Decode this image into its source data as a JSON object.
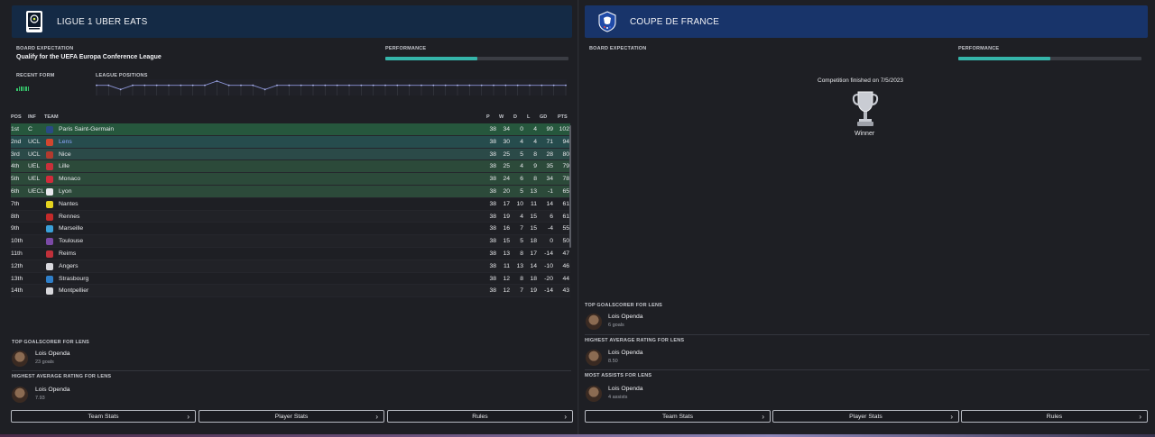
{
  "league": {
    "title": "LIGUE 1 UBER EATS",
    "board_expectation_label": "BOARD EXPECTATION",
    "board_expectation_value": "Qualify for the UEFA Europa Conference League",
    "performance_label": "PERFORMANCE",
    "performance_fill": 0.5,
    "recent_form_label": "RECENT FORM",
    "league_positions_label": "LEAGUE POSITIONS",
    "positions_history": [
      2,
      2,
      3,
      2,
      2,
      2,
      2,
      2,
      2,
      2,
      1,
      2,
      2,
      2,
      3,
      2,
      2,
      2,
      2,
      2,
      2,
      2,
      2,
      2,
      2,
      2,
      2,
      2,
      2,
      2,
      2,
      2,
      2,
      2,
      2,
      2,
      2,
      2,
      2,
      2
    ],
    "table": {
      "headers": [
        "POS",
        "INF",
        "TEAM",
        "P",
        "W",
        "D",
        "L",
        "GD",
        "PTS"
      ],
      "rows": [
        {
          "pos": "1st",
          "inf": "C",
          "team": "Paris Saint-Germain",
          "p": "38",
          "w": "34",
          "d": "0",
          "l": "4",
          "gd": "99",
          "pts": "102",
          "crest": "#2a4a86",
          "zone": "c1"
        },
        {
          "pos": "2nd",
          "inf": "UCL",
          "team": "Lens",
          "p": "38",
          "w": "30",
          "d": "4",
          "l": "4",
          "gd": "71",
          "pts": "94",
          "crest": "#d1462f",
          "zone": "c2",
          "highlight": true
        },
        {
          "pos": "3rd",
          "inf": "UCL",
          "team": "Nice",
          "p": "38",
          "w": "25",
          "d": "5",
          "l": "8",
          "gd": "28",
          "pts": "80",
          "crest": "#b33a2e",
          "zone": "c3"
        },
        {
          "pos": "4th",
          "inf": "UEL",
          "team": "Lille",
          "p": "38",
          "w": "25",
          "d": "4",
          "l": "9",
          "gd": "35",
          "pts": "79",
          "crest": "#c8303a",
          "zone": "c4"
        },
        {
          "pos": "5th",
          "inf": "UEL",
          "team": "Monaco",
          "p": "38",
          "w": "24",
          "d": "6",
          "l": "8",
          "gd": "34",
          "pts": "78",
          "crest": "#d12b3b",
          "zone": "c4"
        },
        {
          "pos": "6th",
          "inf": "UECL",
          "team": "Lyon",
          "p": "38",
          "w": "20",
          "d": "5",
          "l": "13",
          "gd": "-1",
          "pts": "65",
          "crest": "#e8e8ec",
          "zone": "c4"
        },
        {
          "pos": "7th",
          "inf": "",
          "team": "Nantes",
          "p": "38",
          "w": "17",
          "d": "10",
          "l": "11",
          "gd": "14",
          "pts": "61",
          "crest": "#e5d31f",
          "zone": "even"
        },
        {
          "pos": "8th",
          "inf": "",
          "team": "Rennes",
          "p": "38",
          "w": "19",
          "d": "4",
          "l": "15",
          "gd": "6",
          "pts": "61",
          "crest": "#c42a2a",
          "zone": "odd"
        },
        {
          "pos": "9th",
          "inf": "",
          "team": "Marseille",
          "p": "38",
          "w": "16",
          "d": "7",
          "l": "15",
          "gd": "-4",
          "pts": "55",
          "crest": "#3aa0d8",
          "zone": "even"
        },
        {
          "pos": "10th",
          "inf": "",
          "team": "Toulouse",
          "p": "38",
          "w": "15",
          "d": "5",
          "l": "18",
          "gd": "0",
          "pts": "50",
          "crest": "#7b4aa6",
          "zone": "odd"
        },
        {
          "pos": "11th",
          "inf": "",
          "team": "Reims",
          "p": "38",
          "w": "13",
          "d": "8",
          "l": "17",
          "gd": "-14",
          "pts": "47",
          "crest": "#c0303a",
          "zone": "even"
        },
        {
          "pos": "12th",
          "inf": "",
          "team": "Angers",
          "p": "38",
          "w": "11",
          "d": "13",
          "l": "14",
          "gd": "-10",
          "pts": "46",
          "crest": "#d9d9de",
          "zone": "odd"
        },
        {
          "pos": "13th",
          "inf": "",
          "team": "Strasbourg",
          "p": "38",
          "w": "12",
          "d": "8",
          "l": "18",
          "gd": "-20",
          "pts": "44",
          "crest": "#2f7fc9",
          "zone": "even"
        },
        {
          "pos": "14th",
          "inf": "",
          "team": "Montpellier",
          "p": "38",
          "w": "12",
          "d": "7",
          "l": "19",
          "gd": "-14",
          "pts": "43",
          "crest": "#d8d8dc",
          "zone": "odd"
        }
      ]
    },
    "top_goalscorer": {
      "label": "TOP GOALSCORER FOR LENS",
      "name": "Lois Openda",
      "stat": "23 goals"
    },
    "highest_rating": {
      "label": "HIGHEST AVERAGE RATING FOR LENS",
      "name": "Lois Openda",
      "stat": "7.93"
    },
    "buttons": {
      "team_stats": "Team Stats",
      "player_stats": "Player Stats",
      "rules": "Rules"
    }
  },
  "cup": {
    "title": "COUPE DE FRANCE",
    "board_expectation_label": "BOARD EXPECTATION",
    "performance_label": "PERFORMANCE",
    "performance_fill": 0.5,
    "finished_text": "Competition finished on 7/5/2023",
    "result_text": "Winner",
    "top_goalscorer": {
      "label": "TOP GOALSCORER FOR LENS",
      "name": "Lois Openda",
      "stat": "6 goals"
    },
    "highest_rating": {
      "label": "HIGHEST AVERAGE RATING FOR LENS",
      "name": "Lois Openda",
      "stat": "8.50"
    },
    "most_assists": {
      "label": "MOST ASSISTS FOR LENS",
      "name": "Lois Openda",
      "stat": "4 assists"
    },
    "buttons": {
      "team_stats": "Team Stats",
      "player_stats": "Player Stats",
      "rules": "Rules"
    }
  },
  "colors": {
    "accent": "#35b5aa",
    "form": "#35c46a",
    "league_header": "#142a45",
    "cup_header": "#18346a"
  }
}
